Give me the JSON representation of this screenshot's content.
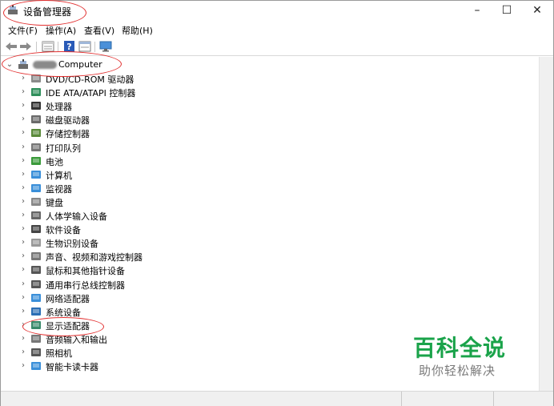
{
  "window": {
    "title": "设备管理器",
    "controls": {
      "minimize": "–",
      "maximize": "☐",
      "close": "✕"
    }
  },
  "menu": [
    "文件(F)",
    "操作(A)",
    "查看(V)",
    "帮助(H)"
  ],
  "toolbar": [
    "back-icon",
    "forward-icon",
    "properties-icon",
    "help-icon",
    "details-icon",
    "monitor-icon"
  ],
  "tree": {
    "root": {
      "label": "Computer",
      "expanded": true
    },
    "items": [
      {
        "label": "DVD/CD-ROM 驱动器",
        "icon": "disc-drive-icon"
      },
      {
        "label": "IDE ATA/ATAPI 控制器",
        "icon": "ide-controller-icon"
      },
      {
        "label": "处理器",
        "icon": "processor-icon"
      },
      {
        "label": "磁盘驱动器",
        "icon": "disk-drive-icon"
      },
      {
        "label": "存储控制器",
        "icon": "storage-controller-icon"
      },
      {
        "label": "打印队列",
        "icon": "printer-icon"
      },
      {
        "label": "电池",
        "icon": "battery-icon"
      },
      {
        "label": "计算机",
        "icon": "computer-icon"
      },
      {
        "label": "监视器",
        "icon": "monitor-icon"
      },
      {
        "label": "键盘",
        "icon": "keyboard-icon"
      },
      {
        "label": "人体学输入设备",
        "icon": "hid-icon"
      },
      {
        "label": "软件设备",
        "icon": "software-device-icon"
      },
      {
        "label": "生物识别设备",
        "icon": "biometric-icon"
      },
      {
        "label": "声音、视频和游戏控制器",
        "icon": "sound-icon"
      },
      {
        "label": "鼠标和其他指针设备",
        "icon": "mouse-icon"
      },
      {
        "label": "通用串行总线控制器",
        "icon": "usb-icon"
      },
      {
        "label": "网络适配器",
        "icon": "network-adapter-icon"
      },
      {
        "label": "系统设备",
        "icon": "system-device-icon"
      },
      {
        "label": "显示适配器",
        "icon": "display-adapter-icon"
      },
      {
        "label": "音频输入和输出",
        "icon": "audio-io-icon"
      },
      {
        "label": "照相机",
        "icon": "camera-icon"
      },
      {
        "label": "智能卡读卡器",
        "icon": "smart-card-reader-icon"
      }
    ]
  },
  "watermark": {
    "main": "百科全说",
    "sub": "助你轻松解决"
  },
  "colors": {
    "annotation": "#e23030",
    "watermark": "#1aa34a"
  }
}
